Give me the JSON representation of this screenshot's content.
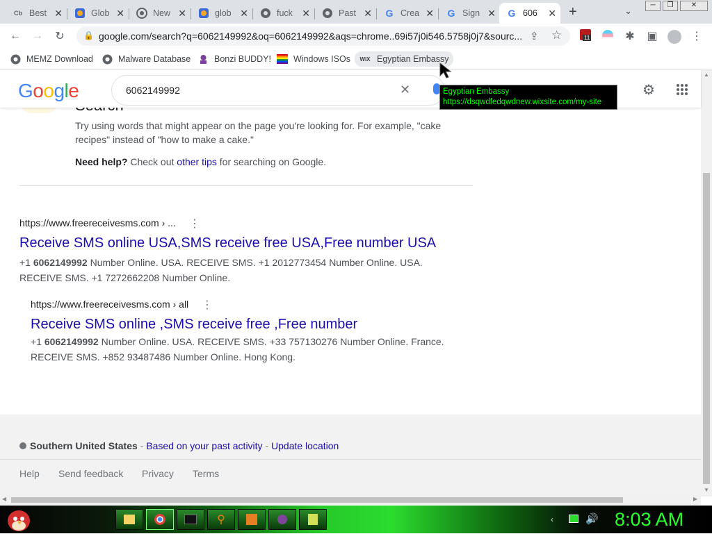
{
  "tabs": [
    {
      "title": "Best",
      "favicon": "Cb",
      "favicon_color": "#111111"
    },
    {
      "title": "Glob",
      "favicon": "g",
      "favicon_color": "#3b6bd6"
    },
    {
      "title": "New",
      "favicon": "chrome",
      "favicon_color": "#5f6368"
    },
    {
      "title": "glob",
      "favicon": "g",
      "favicon_color": "#3b6bd6"
    },
    {
      "title": "fuck",
      "favicon": "globe",
      "favicon_color": "#5f6368"
    },
    {
      "title": "Past",
      "favicon": "globe",
      "favicon_color": "#5f6368"
    },
    {
      "title": "Crea",
      "favicon": "G",
      "favicon_color": "#4285f4"
    },
    {
      "title": "Sign",
      "favicon": "G",
      "favicon_color": "#4285f4"
    },
    {
      "title": "606",
      "favicon": "G",
      "favicon_color": "#4285f4",
      "active": true
    }
  ],
  "address_bar": {
    "url": "google.com/search?q=6062149992&oq=6062149992&aqs=chrome..69i57j0i546.5758j0j7&sourc..."
  },
  "extension_badge": "11",
  "bookmarks": [
    {
      "label": "MEMZ Download",
      "icon": "globe-icon"
    },
    {
      "label": "Malware Database",
      "icon": "globe-icon"
    },
    {
      "label": "Bonzi BUDDY!",
      "icon": "bonzi-icon"
    },
    {
      "label": "Windows ISOs",
      "icon": "windows-icon"
    },
    {
      "label": "Egyptian Embassy",
      "icon": "wix-icon",
      "icon_text": "WiX"
    }
  ],
  "google": {
    "logo": "Google",
    "query": "6062149992"
  },
  "tips": {
    "partial_heading": "Search",
    "line1": "Try using words that might appear on the page you're looking for. For example, \"cake",
    "line2": "recipes\" instead of \"how to make a cake.\"",
    "help_bold": "Need help?",
    "help_text1": " Check out ",
    "help_link": "other tips",
    "help_text2": " for searching on Google."
  },
  "results": [
    {
      "url": "https://www.freereceivesms.com › ...",
      "title": "Receive SMS online USA,SMS receive free USA,Free number USA",
      "snippet_prefix": "+1 ",
      "snippet_bold": "6062149992",
      "snippet_line1_rest": " Number Online. USA. RECEIVE SMS. +1 2012773454 Number Online. USA.",
      "snippet_line2": "RECEIVE SMS. +1 7272662208 Number Online."
    },
    {
      "url": "https://www.freereceivesms.com › all",
      "title": "Receive SMS online ,SMS receive free ,Free number",
      "snippet_prefix": "+1 ",
      "snippet_bold": "6062149992",
      "snippet_line1_rest": " Number Online. USA. RECEIVE SMS. +33 757130276 Number Online. France.",
      "snippet_line2": "RECEIVE SMS. +852 93487486 Number Online. Hong Kong."
    }
  ],
  "footer": {
    "location": "Southern United States",
    "sep1": " - ",
    "activity": "Based on your past activity",
    "sep2": " - ",
    "update": "Update location",
    "links": [
      "Help",
      "Send feedback",
      "Privacy",
      "Terms"
    ]
  },
  "tooltip": {
    "title": "Egyptian Embassy",
    "url": "https://dsqwdfedqwdnew.wixsite.com/my-site"
  },
  "taskbar": {
    "clock": "8:03 AM"
  },
  "colors": {
    "link_blue": "#1a0dab",
    "footer_link": "#1a0dab",
    "tooltip_text": "#00ff00",
    "clock_green": "#2bff2b"
  }
}
